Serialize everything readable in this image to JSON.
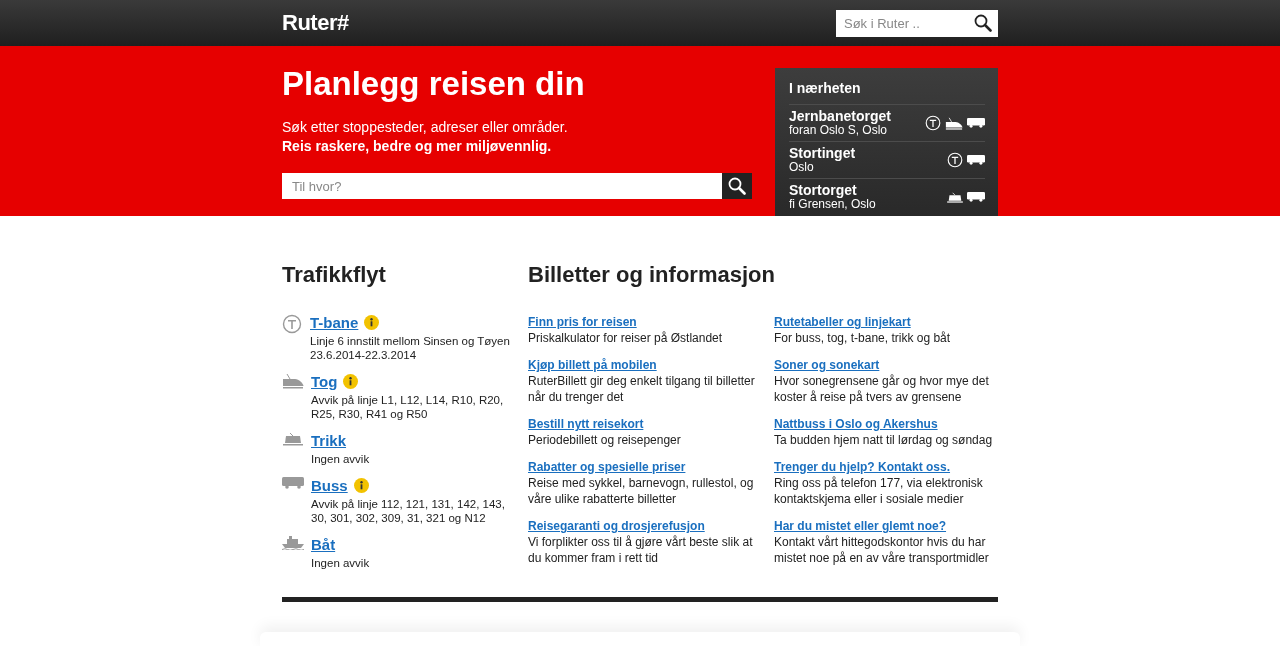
{
  "header": {
    "logo": "Ruter#",
    "search": {
      "placeholder": "Søk i Ruter .."
    }
  },
  "hero": {
    "title": "Planlegg reisen din",
    "subtitle": "Søk etter stoppesteder, adreser eller områder.",
    "tagline": "Reis raskere, bedre og mer miljøvennlig.",
    "search": {
      "placeholder": "Til hvor?"
    }
  },
  "nearby": {
    "title": "I nærheten",
    "stops": [
      {
        "name": "Jernbanetorget",
        "place": "foran Oslo S, Oslo",
        "modes": [
          {
            "kind": "tbane"
          },
          {
            "kind": "tog"
          },
          {
            "kind": "buss"
          }
        ]
      },
      {
        "name": "Stortinget",
        "place": "Oslo",
        "modes": [
          {
            "kind": "tbane"
          },
          {
            "kind": "buss"
          }
        ]
      },
      {
        "name": "Stortorget",
        "place": "fi Grensen, Oslo",
        "modes": [
          {
            "kind": "trikk"
          },
          {
            "kind": "buss"
          }
        ]
      }
    ]
  },
  "traffic": {
    "title": "Trafikkflyt",
    "items": [
      {
        "kind": "tbane",
        "label": "T-bane",
        "info": true,
        "text": "Linje 6 innstilt mellom Sinsen og Tøyen 23.6.2014-22.3.2014"
      },
      {
        "kind": "tog",
        "label": "Tog",
        "info": true,
        "text": "Avvik på linje L1, L12, L14, R10, R20, R25, R30, R41 og R50"
      },
      {
        "kind": "trikk",
        "label": "Trikk",
        "info": false,
        "text": "Ingen avvik"
      },
      {
        "kind": "buss",
        "label": "Buss",
        "info": true,
        "text": "Avvik på linje 112, 121, 131, 142, 143, 30, 301, 302, 309, 31, 321 og N12"
      },
      {
        "kind": "baat",
        "label": "Båt",
        "info": false,
        "text": "Ingen avvik"
      }
    ]
  },
  "tickets": {
    "title": "Billetter og informasjon",
    "links": [
      {
        "label": "Finn pris for reisen",
        "text": "Priskalkulator for reiser på Østlandet"
      },
      {
        "label": "Kjøp billett på mobilen",
        "text": "RuterBillett gir deg enkelt tilgang til billetter når du trenger det"
      },
      {
        "label": "Bestill nytt reisekort",
        "text": "Periodebillett og reisepenger"
      },
      {
        "label": "Rabatter og spesielle priser",
        "text": "Reise med sykkel, barnevogn, rullestol, og våre ulike rabatterte billetter"
      },
      {
        "label": "Reisegaranti og drosjerefusjon",
        "text": "Vi forplikter oss til å gjøre vårt beste slik at du kommer fram i rett tid"
      },
      {
        "label": "Rutetabeller og linjekart",
        "text": "For buss, tog, t-bane, trikk og båt"
      },
      {
        "label": "Soner og sonekart",
        "text": "Hvor sonegrensene går og hvor mye det koster å reise på tvers av grensene"
      },
      {
        "label": "Nattbuss i Oslo og Akershus",
        "text": "Ta budden hjem natt til lørdag og søndag"
      },
      {
        "label": "Trenger du hjelp? Kontakt oss.",
        "text": "Ring oss på telefon 177, via elektronisk kontaktskjema eller i sosiale medier"
      },
      {
        "label": "Har du mistet eller glemt noe?",
        "text": "Kontakt vårt hittegodskontor hvis du har mistet noe på en av våre transportmidler"
      }
    ]
  }
}
